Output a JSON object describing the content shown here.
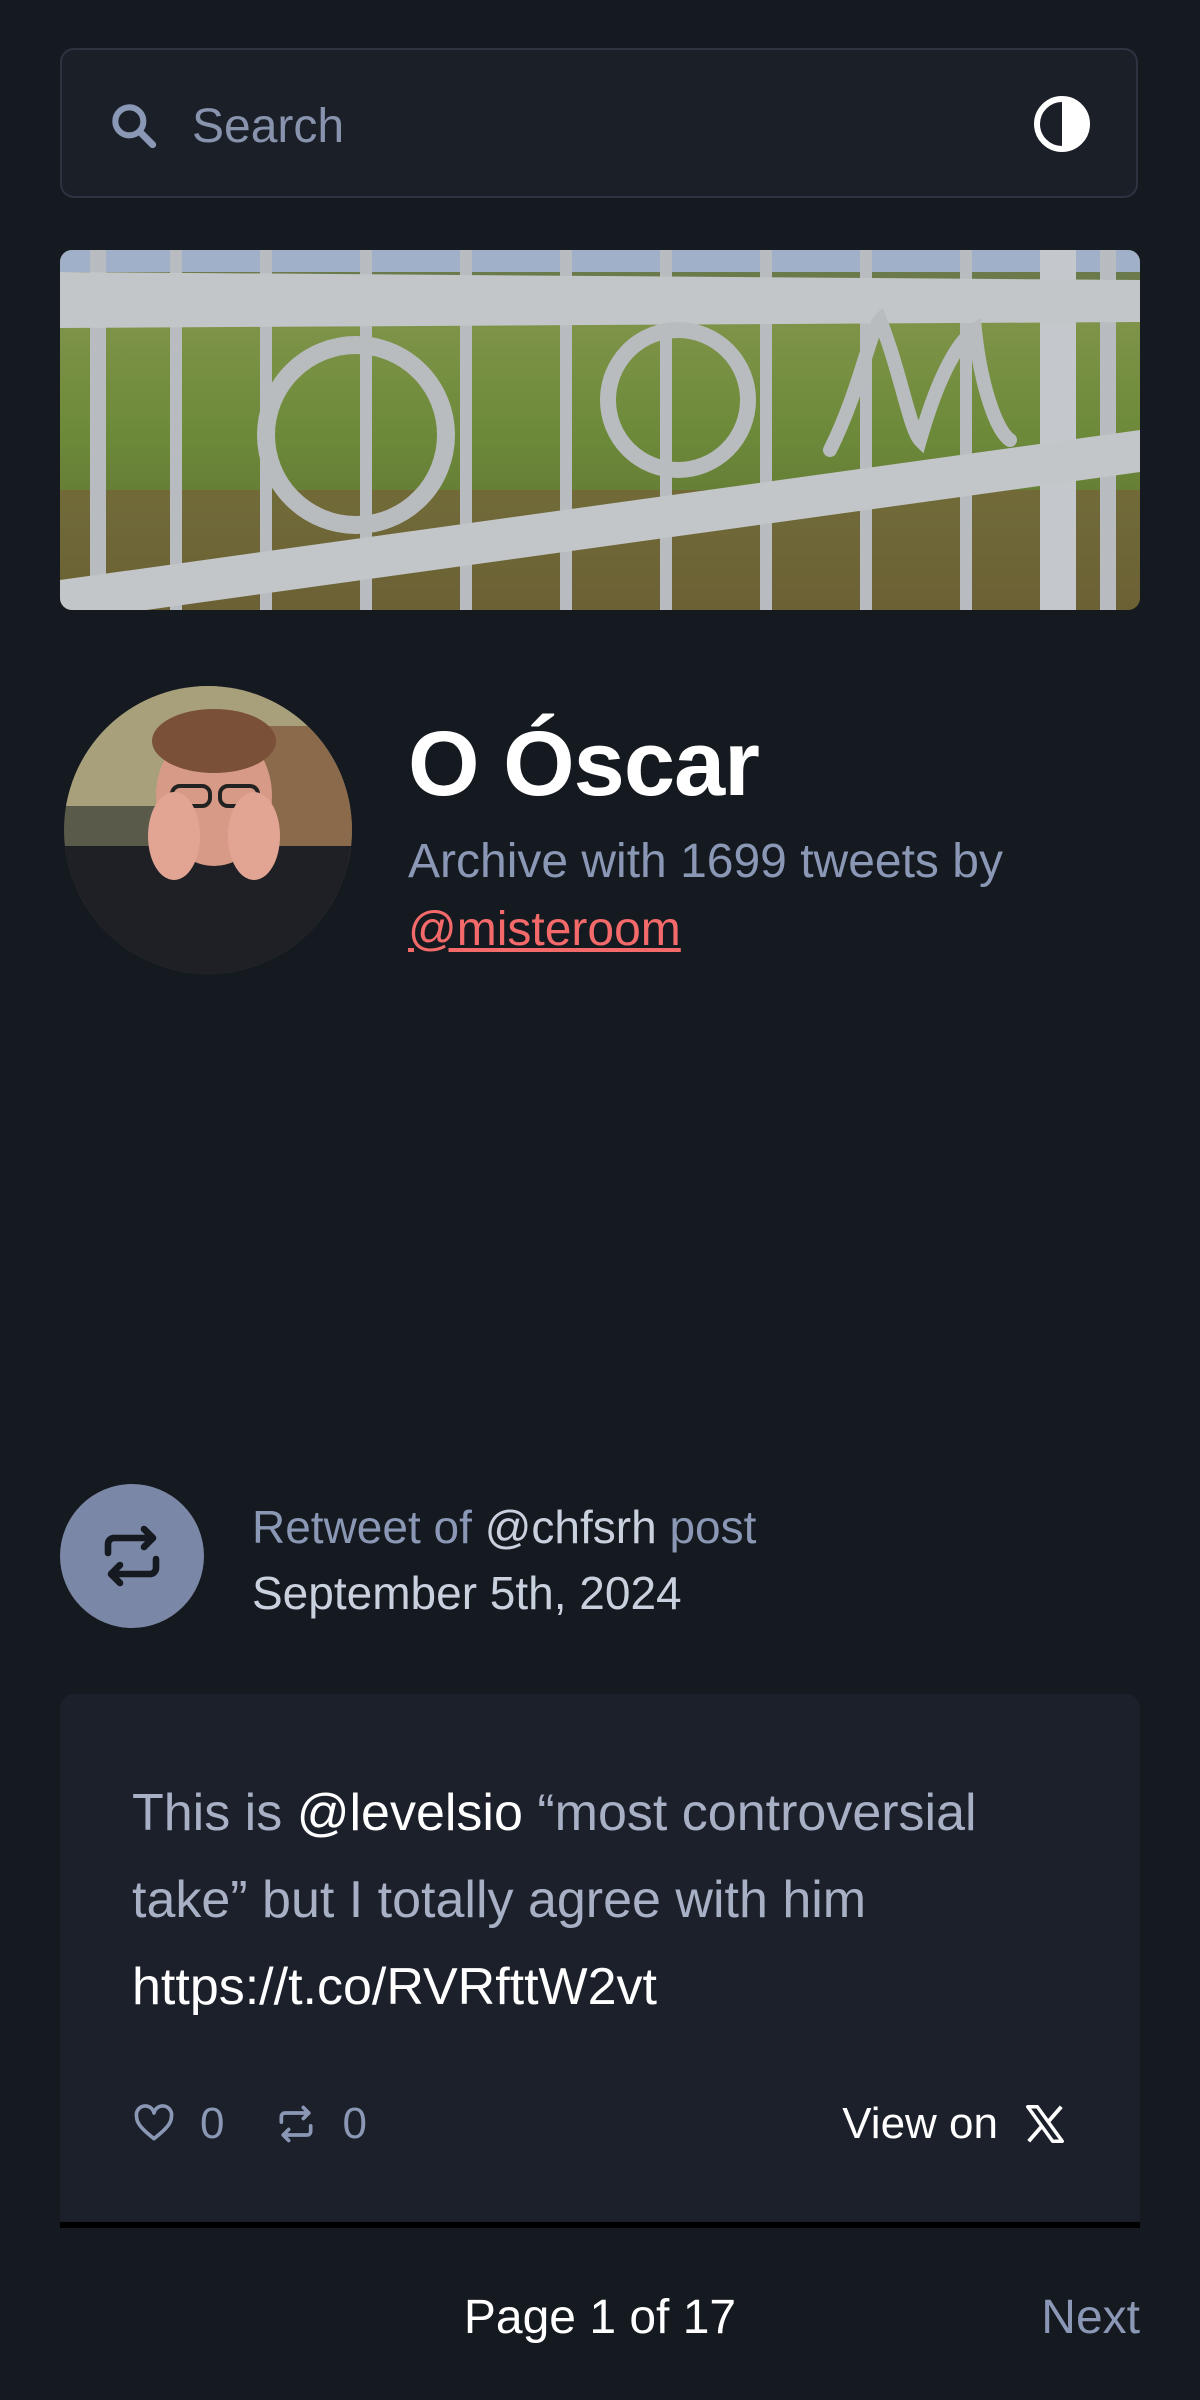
{
  "search": {
    "placeholder": "Search"
  },
  "icons": {
    "search": "search-icon",
    "theme_toggle": "contrast-half-circle-icon",
    "retweet": "retweet-icon",
    "like": "heart-icon",
    "x_logo": "x-logo-icon"
  },
  "profile": {
    "name": "O Óscar",
    "desc_prefix": "Archive with 1699 tweets by",
    "handle": "@misteroom"
  },
  "tweet": {
    "retweet_prefix": "Retweet of",
    "retweet_user": "@chfsrh",
    "retweet_suffix": "post",
    "date": "September 5th, 2024",
    "text_part1": "This is ",
    "mention": "@levelsio",
    "text_part2": " “most controversial take” but I totally agree with him ",
    "link": "https://t.co/RVRfttW2vt",
    "likes": "0",
    "retweets": "0",
    "view_on_label": "View on"
  },
  "pagination": {
    "page_label": "Page 1 of 17",
    "next_label": "Next"
  },
  "colors": {
    "background": "#151920",
    "card": "#1c202a",
    "accent_link": "#f46a6a",
    "muted_text": "#8a97b5"
  }
}
